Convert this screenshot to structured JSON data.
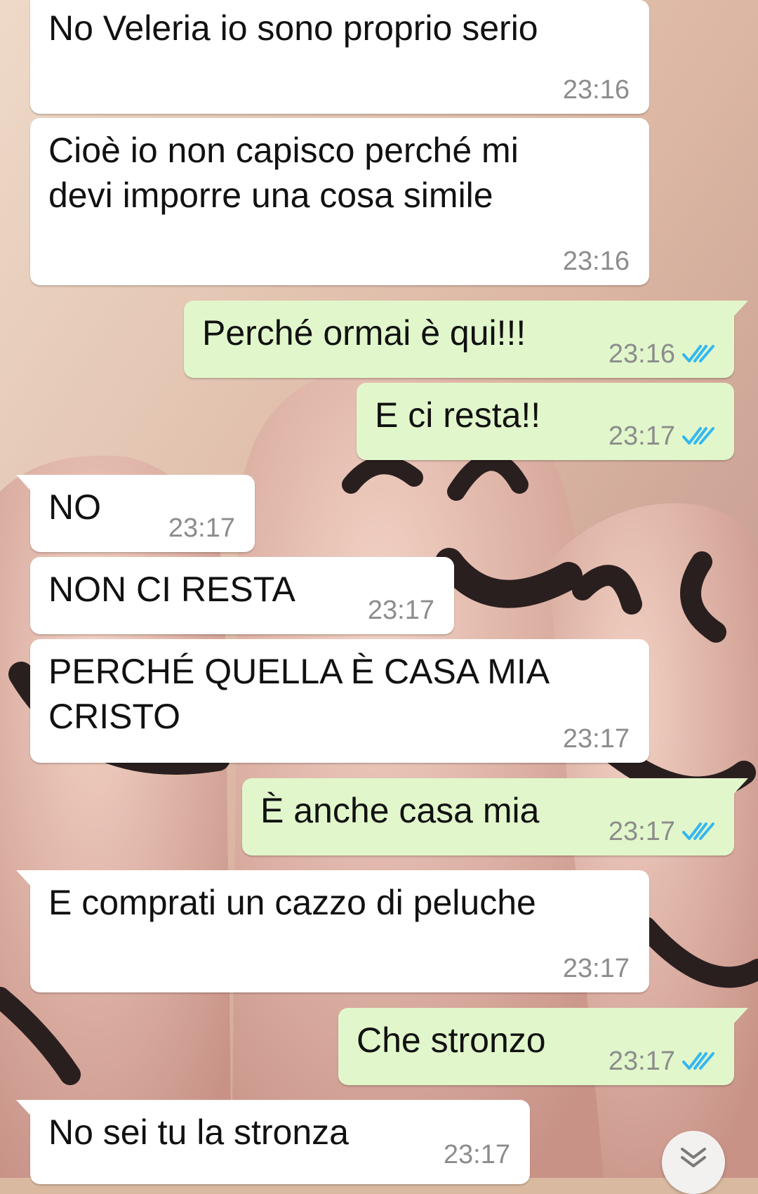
{
  "colors": {
    "incoming_bubble": "#ffffff",
    "outgoing_bubble": "#e1f7cb",
    "read_ticks": "#34b7f1",
    "timestamp": "#8c8c8c"
  },
  "messages": [
    {
      "direction": "incoming",
      "text": "No Veleria io sono proprio serio",
      "time": "23:16"
    },
    {
      "direction": "incoming",
      "text": "Cioè io non capisco perché mi\ndevi imporre una cosa simile",
      "time": "23:16"
    },
    {
      "direction": "outgoing",
      "text": "Perché ormai è qui!!!",
      "time": "23:16",
      "status_icon": "double-check-read"
    },
    {
      "direction": "outgoing",
      "text": "E ci resta!!",
      "time": "23:17",
      "status_icon": "double-check-read"
    },
    {
      "direction": "incoming",
      "text": "NO",
      "time": "23:17"
    },
    {
      "direction": "incoming",
      "text": "NON CI RESTA",
      "time": "23:17"
    },
    {
      "direction": "incoming",
      "text": "PERCHÉ QUELLA È CASA MIA\nCRISTO",
      "time": "23:17"
    },
    {
      "direction": "outgoing",
      "text": "È anche casa mia",
      "time": "23:17",
      "status_icon": "double-check-read"
    },
    {
      "direction": "incoming",
      "text": "E comprati un cazzo di peluche",
      "time": "23:17"
    },
    {
      "direction": "outgoing",
      "text": "Che stronzo",
      "time": "23:17",
      "status_icon": "double-check-read"
    },
    {
      "direction": "incoming",
      "text": "No sei tu la stronza",
      "time": "23:17"
    }
  ],
  "scroll_button_icon": "double-chevron-down-icon"
}
